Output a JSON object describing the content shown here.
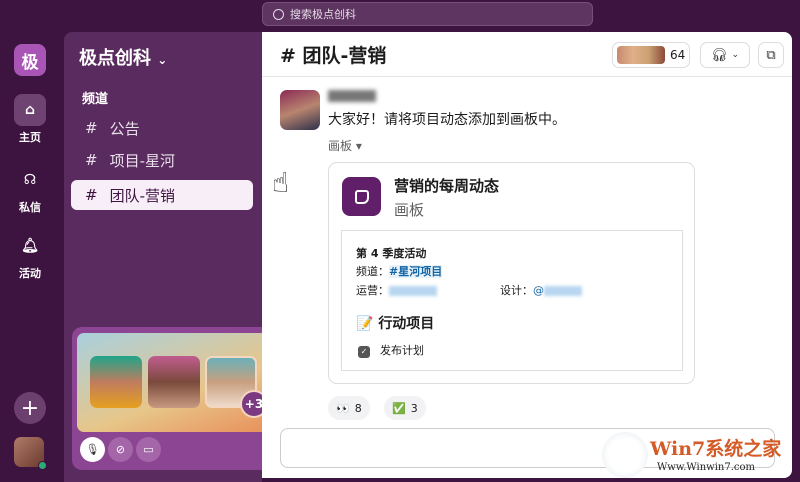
{
  "search": {
    "placeholder": "搜索极点创科"
  },
  "rail": {
    "workspace_initial": "极",
    "items": [
      {
        "label": "主页",
        "icon": "home-icon"
      },
      {
        "label": "私信",
        "icon": "dm-icon"
      },
      {
        "label": "活动",
        "icon": "bell-icon"
      }
    ],
    "add": "+"
  },
  "sidebar": {
    "workspace": "极点创科",
    "section": "频道",
    "channels": [
      {
        "name": "公告",
        "active": false
      },
      {
        "name": "项目-星河",
        "active": false
      },
      {
        "name": "团队-营销",
        "active": true
      }
    ]
  },
  "huddle": {
    "extra": "+3"
  },
  "header": {
    "title": "# 团队-营销",
    "member_count": "64"
  },
  "message": {
    "text": "大家好！请将项目动态添加到画板中。",
    "attachment_label": "画板 ▾"
  },
  "card": {
    "title": "营销的每周动态",
    "subtitle": "画板",
    "heading": "第 4 季度活动",
    "channel_label": "频道：",
    "channel_link": "#星河项目",
    "ops_label": "运营：",
    "design_label": "设计：",
    "design_at": "@",
    "section": "行动项目",
    "task": "发布计划"
  },
  "reactions": [
    {
      "emoji": "👀",
      "count": "8"
    },
    {
      "emoji": "✅",
      "count": "3"
    }
  ],
  "watermark": {
    "title": "Win7系统之家",
    "url": "Www.Winwin7.com"
  },
  "colors": {
    "aubergine": "#3d1340",
    "sidebar": "#5a2b5e",
    "accent": "#611f69",
    "link": "#1264a3"
  }
}
